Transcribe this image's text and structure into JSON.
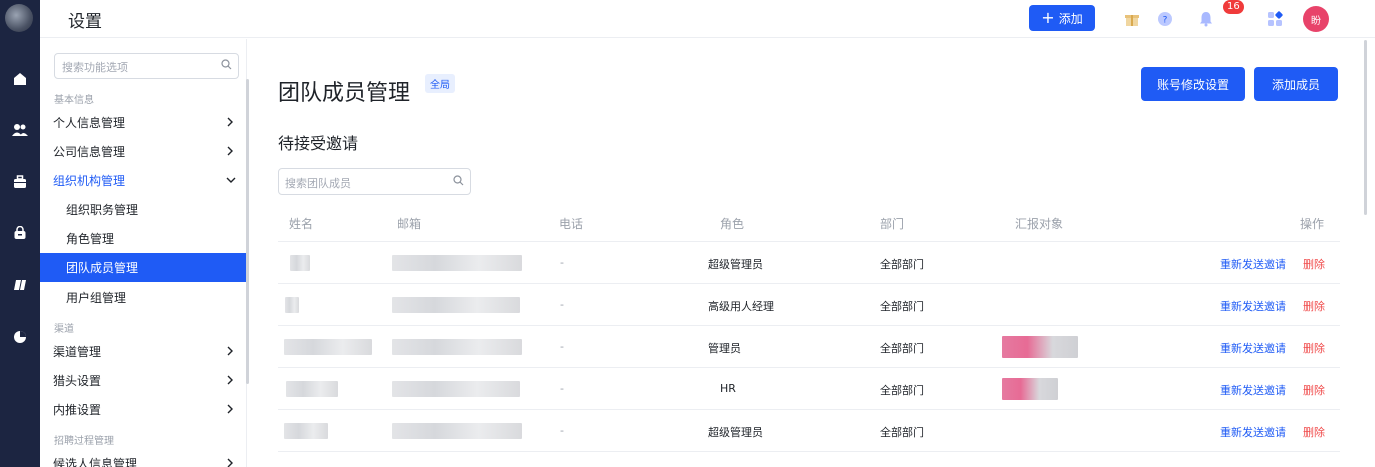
{
  "header": {
    "title": "设置",
    "add_label": "添加",
    "notification_count": "16",
    "user_initial": "盼"
  },
  "sidebar": {
    "search_placeholder": "搜索功能选项",
    "sections": [
      "基本信息",
      "渠道",
      "招聘过程管理"
    ],
    "items": [
      {
        "label": "个人信息管理"
      },
      {
        "label": "公司信息管理"
      },
      {
        "label": "组织机构管理"
      },
      {
        "label": "组织职务管理"
      },
      {
        "label": "角色管理"
      },
      {
        "label": "团队成员管理"
      },
      {
        "label": "用户组管理"
      },
      {
        "label": "渠道管理"
      },
      {
        "label": "猎头设置"
      },
      {
        "label": "内推设置"
      },
      {
        "label": "候选人信息管理"
      }
    ]
  },
  "main": {
    "title": "团队成员管理",
    "scope_tag": "全局",
    "account_settings_label": "账号修改设置",
    "add_member_label": "添加成员",
    "subtitle": "待接受邀请",
    "search_placeholder": "搜索团队成员",
    "columns": [
      "姓名",
      "邮箱",
      "电话",
      "角色",
      "部门",
      "汇报对象",
      "操作"
    ],
    "rows": [
      {
        "phone": "-",
        "role": "超级管理员",
        "dept": "全部部门",
        "resend": "重新发送邀请",
        "delete": "删除"
      },
      {
        "phone": "-",
        "role": "高级用人经理",
        "dept": "全部部门",
        "resend": "重新发送邀请",
        "delete": "删除"
      },
      {
        "phone": "-",
        "role": "管理员",
        "dept": "全部部门",
        "resend": "重新发送邀请",
        "delete": "删除"
      },
      {
        "phone": "-",
        "role": "HR",
        "dept": "全部部门",
        "resend": "重新发送邀请",
        "delete": "删除"
      },
      {
        "phone": "-",
        "role": "超级管理员",
        "dept": "全部部门",
        "resend": "重新发送邀请",
        "delete": "删除"
      }
    ]
  },
  "colors": {
    "primary": "#1f5bf5",
    "rail": "#1c2541",
    "danger": "#f04a4a",
    "badge": "#f03b3b",
    "avatar": "#e8436a"
  },
  "icons": [
    "home-icon",
    "team-icon",
    "briefcase-icon",
    "lock-icon",
    "book-icon",
    "pie-chart-icon",
    "gift-icon",
    "help-icon",
    "bell-icon",
    "apps-icon",
    "search-icon",
    "chevron-right-icon",
    "chevron-down-icon"
  ]
}
